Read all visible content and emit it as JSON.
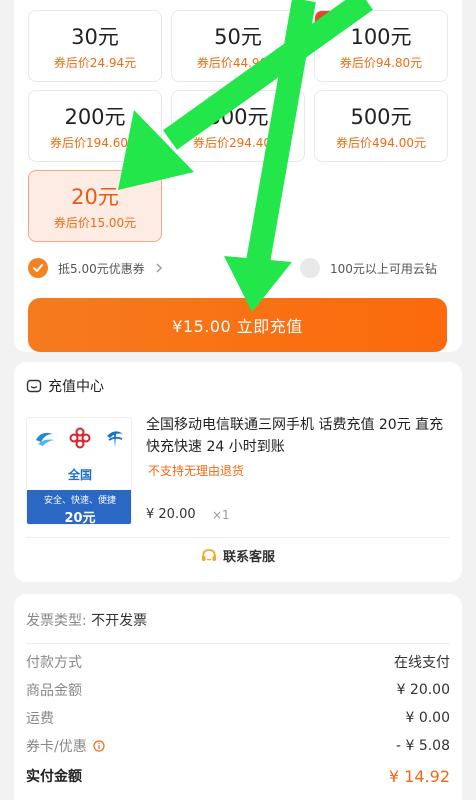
{
  "denominations": [
    {
      "amount": "30元",
      "price": "券后价24.94元",
      "selected": false,
      "badge": ""
    },
    {
      "amount": "50元",
      "price": "券后价44.90元",
      "selected": false,
      "badge": ""
    },
    {
      "amount": "100元",
      "price": "券后价94.80元",
      "selected": false,
      "badge": "hot"
    },
    {
      "amount": "200元",
      "price": "券后价194.60元",
      "selected": false,
      "badge": ""
    },
    {
      "amount": "300元",
      "price": "券后价294.40元",
      "selected": false,
      "badge": ""
    },
    {
      "amount": "500元",
      "price": "券后价494.00元",
      "selected": false,
      "badge": ""
    },
    {
      "amount": "20元",
      "price": "券后价15.00元",
      "selected": true,
      "badge": ""
    }
  ],
  "coupon": {
    "label": "抵5.00元优惠券"
  },
  "cloud": {
    "label": "100元以上可用云钻"
  },
  "pay_button": {
    "label": "¥15.00 立即充值"
  },
  "shop": {
    "name": "充值中心"
  },
  "product": {
    "title": "全国移动电信联通三网手机 话费充值 20元 直充快充快速 24 小时到账",
    "notice": "不支持无理由退货",
    "price": "¥ 20.00",
    "qty": "×1",
    "image": {
      "region": "全国",
      "tag": "安全、快速、便捷",
      "value": "20元"
    }
  },
  "service": {
    "label": "联系客服"
  },
  "invoice": {
    "label": "发票类型:",
    "value": "不开发票"
  },
  "summary": [
    {
      "label": "付款方式",
      "value": "在线支付"
    },
    {
      "label": "商品金额",
      "value": "¥ 20.00"
    },
    {
      "label": "运费",
      "value": "¥ 0.00"
    },
    {
      "label": "券卡/优惠",
      "value": "- ¥ 5.08"
    },
    {
      "label": "实付金额",
      "value": "¥ 14.92"
    }
  ],
  "colors": {
    "accent": "#f58220",
    "price": "#f06a14",
    "arrow": "#22e64a"
  }
}
